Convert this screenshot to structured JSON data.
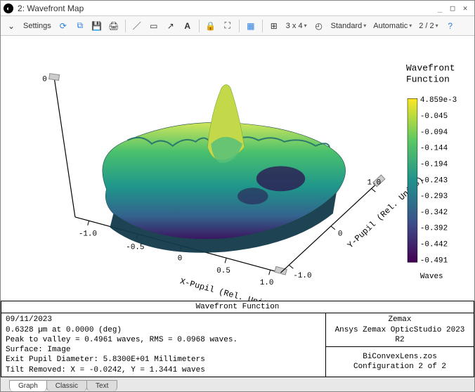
{
  "window": {
    "index": "2",
    "title": "Wavefront Map"
  },
  "toolbar": {
    "settings_label": "Settings",
    "grid_label": "3 x 4",
    "config_label": "Standard",
    "auto_label": "Automatic",
    "pager": "2 / 2"
  },
  "plot": {
    "legend_title1": "Wavefront",
    "legend_title2": "Function",
    "legend_unit": "Waves",
    "x_axis": "X-Pupil (Rel. Units)",
    "y_axis": "Y-Pupil (Rel. Units)",
    "z_tick": "0",
    "x_ticks": [
      "-1.0",
      "-0.5",
      "0",
      "0.5",
      "1.0"
    ],
    "y_ticks": [
      "-1.0",
      "0",
      "1.0"
    ],
    "colorbar_ticks": [
      "4.859e-3",
      "-0.045",
      "-0.094",
      "-0.144",
      "-0.194",
      "-0.243",
      "-0.293",
      "-0.342",
      "-0.392",
      "-0.442",
      "-0.491"
    ]
  },
  "info": {
    "header": "Wavefront Function",
    "date": "09/11/2023",
    "line1": "0.6328 µm at 0.0000 (deg)",
    "line2": "Peak to valley = 0.4961 waves, RMS = 0.0968 waves.",
    "line3": "Surface: Image",
    "line4": "Exit Pupil Diameter: 5.8300E+01 Millimeters",
    "line5": "Tilt Removed: X = -0.0242, Y = 1.3441 waves",
    "vendor1": "Zemax",
    "vendor2": "Ansys Zemax OpticStudio 2023 R2",
    "file": "BiConvexLens.zos",
    "config": "Configuration 2 of 2"
  },
  "tabs": {
    "t1": "Graph",
    "t2": "Classic",
    "t3": "Text"
  },
  "chart_data": {
    "type": "surface3d",
    "title": "Wavefront Function",
    "xlabel": "X-Pupil (Rel. Units)",
    "ylabel": "Y-Pupil (Rel. Units)",
    "zlabel": "Waves",
    "xlim": [
      -1.0,
      1.0
    ],
    "ylim": [
      -1.0,
      1.0
    ],
    "zlim": [
      -0.491,
      0.004859
    ],
    "x_ticks": [
      -1.0,
      -0.5,
      0,
      0.5,
      1.0
    ],
    "y_ticks": [
      -1.0,
      0,
      1.0
    ],
    "z_ticks": [
      0
    ],
    "colorbar": {
      "min": -0.491,
      "max": 0.004859,
      "ticks": [
        0.004859,
        -0.045,
        -0.094,
        -0.144,
        -0.194,
        -0.243,
        -0.293,
        -0.342,
        -0.392,
        -0.442,
        -0.491
      ],
      "unit": "Waves",
      "colormap": "viridis"
    },
    "stats": {
      "peak_to_valley_waves": 0.4961,
      "rms_waves": 0.0968,
      "wavelength_um": 0.6328,
      "field_deg": 0.0,
      "exit_pupil_diameter_mm": 58.3,
      "tilt_removed_x_waves": -0.0242,
      "tilt_removed_y_waves": 1.3441
    }
  }
}
